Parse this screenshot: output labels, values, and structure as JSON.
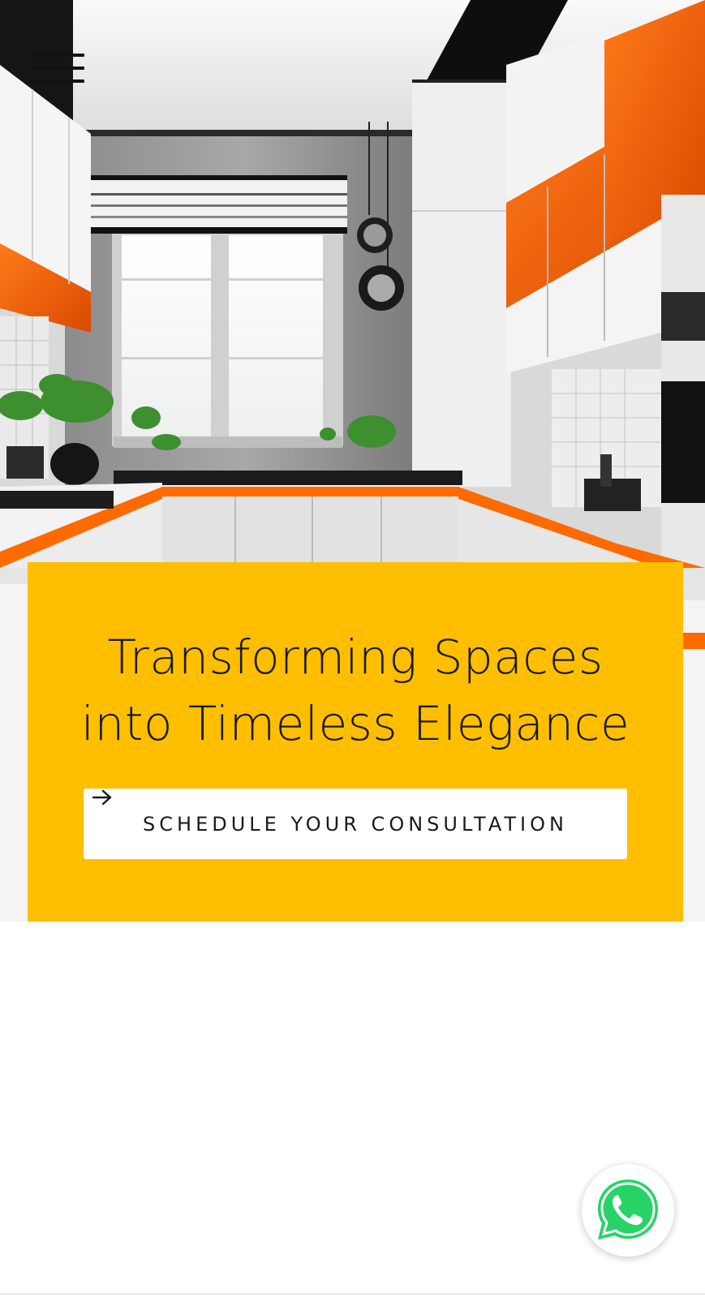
{
  "nav": {
    "menu_icon": "hamburger-menu-icon"
  },
  "hero": {
    "title_line1": "Transforming Spaces",
    "title_line2": "into Timeless Elegance",
    "cta_label": "SCHEDULE YOUR CONSULTATION",
    "cta_icon": "arrow-right-icon",
    "card_color": "#ffbf00"
  },
  "whatsapp": {
    "icon": "whatsapp-icon",
    "color": "#25d366"
  }
}
